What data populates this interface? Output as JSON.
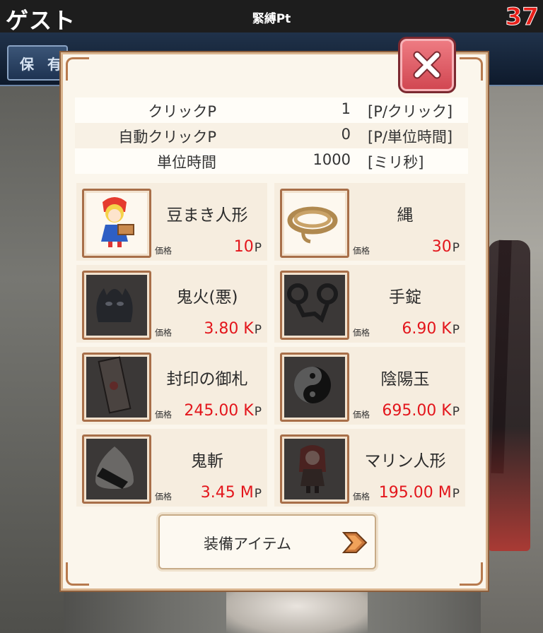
{
  "header": {
    "player_name": "ゲスト",
    "points_label": "緊縛Pt",
    "points_value": "37"
  },
  "tab": {
    "label": "保 有"
  },
  "stats": [
    {
      "label": "クリックP",
      "value": "1",
      "unit": "[P/クリック]"
    },
    {
      "label": "自動クリックP",
      "value": "0",
      "unit": "[P/単位時間]"
    },
    {
      "label": "単位時間",
      "value": "1000",
      "unit": "[ミリ秒]"
    }
  ],
  "price_label": "価格",
  "price_suffix": "P",
  "items": [
    {
      "name": "豆まき人形",
      "price": "10",
      "icon": "doll-girl-icon"
    },
    {
      "name": "縄",
      "price": "30",
      "icon": "rope-icon"
    },
    {
      "name": "鬼火(悪)",
      "price": "3.80 K",
      "icon": "demon-fire-icon"
    },
    {
      "name": "手錠",
      "price": "6.90 K",
      "icon": "handcuffs-icon"
    },
    {
      "name": "封印の御札",
      "price": "245.00 K",
      "icon": "seal-talisman-icon"
    },
    {
      "name": "陰陽玉",
      "price": "695.00 K",
      "icon": "yin-yang-orb-icon"
    },
    {
      "name": "鬼斬",
      "price": "3.45 M",
      "icon": "onigiri-icon"
    },
    {
      "name": "マリン人形",
      "price": "195.00 M",
      "icon": "marine-doll-icon"
    }
  ],
  "equip_button": {
    "label": "装備アイテム"
  },
  "colors": {
    "price": "#e3161c",
    "close": "#d04550",
    "points": "#e71f19"
  }
}
